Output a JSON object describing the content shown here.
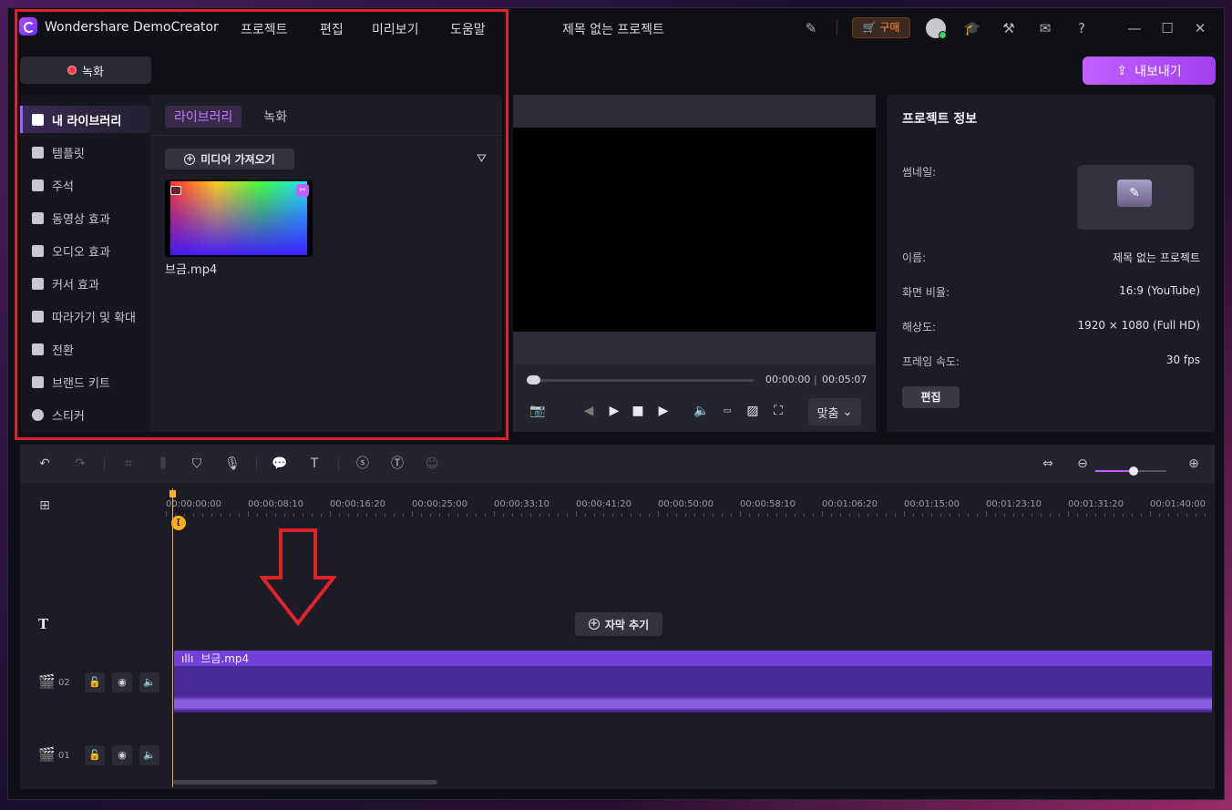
{
  "titlebar": {
    "app_name": "Wondershare DemoCreator",
    "menus": [
      "프로젝트",
      "편집",
      "미리보기",
      "도움말"
    ],
    "document_title": "제목 없는 프로젝트",
    "buy_label": "구매"
  },
  "toolbar": {
    "record_label": "녹화",
    "export_label": "내보내기"
  },
  "library": {
    "sidebar": [
      {
        "label": "내 라이브러리",
        "icon": "layers-icon",
        "active": true
      },
      {
        "label": "템플릿",
        "icon": "template-icon"
      },
      {
        "label": "주석",
        "icon": "annotation-icon"
      },
      {
        "label": "동영상 효과",
        "icon": "video-effect-icon"
      },
      {
        "label": "오디오 효과",
        "icon": "music-note-icon"
      },
      {
        "label": "커서 효과",
        "icon": "cursor-effect-icon"
      },
      {
        "label": "따라가기 및 확대",
        "icon": "pan-zoom-icon"
      },
      {
        "label": "전환",
        "icon": "transition-icon"
      },
      {
        "label": "브랜드 키트",
        "icon": "brand-kit-icon"
      },
      {
        "label": "스티커",
        "icon": "sticker-icon"
      }
    ],
    "tabs": [
      "라이브러리",
      "녹화"
    ],
    "active_tab": "라이브러리",
    "import_label": "미디어 가져오기",
    "media": [
      {
        "name": "브금.mp4"
      }
    ]
  },
  "preview": {
    "current_time": "00:00:00",
    "total_time": "00:05:07",
    "progress": 0.0,
    "fit_label": "맞춤"
  },
  "project_info": {
    "title": "프로젝트 정보",
    "thumbnail_label": "썸네일:",
    "name_label": "이름:",
    "name_value": "제목 없는 프로젝트",
    "ratio_label": "화면 비율:",
    "ratio_value": "16:9 (YouTube)",
    "resolution_label": "해상도:",
    "resolution_value": "1920 × 1080 (Full HD)",
    "framerate_label": "프레임 속도:",
    "framerate_value": "30 fps",
    "edit_label": "편집"
  },
  "timeline": {
    "ruler_ticks": [
      "00:00:00:00",
      "00:00:08:10",
      "00:00:16:20",
      "00:00:25:00",
      "00:00:33:10",
      "00:00:41:20",
      "00:00:50:00",
      "00:00:58:10",
      "00:01:06:20",
      "00:01:15:00",
      "00:01:23:10",
      "00:01:31:20",
      "00:01:40:00"
    ],
    "add_subtitle_label": "자막 추기",
    "tracks": [
      {
        "number": "02",
        "clip": "브금.mp4"
      },
      {
        "number": "01",
        "clip": ""
      }
    ],
    "zoom_level": 0.54
  },
  "colors": {
    "accent": "#c060ff",
    "highlight_frame": "#e0222a",
    "playhead": "#ffb020",
    "clip": "#7040d8"
  }
}
